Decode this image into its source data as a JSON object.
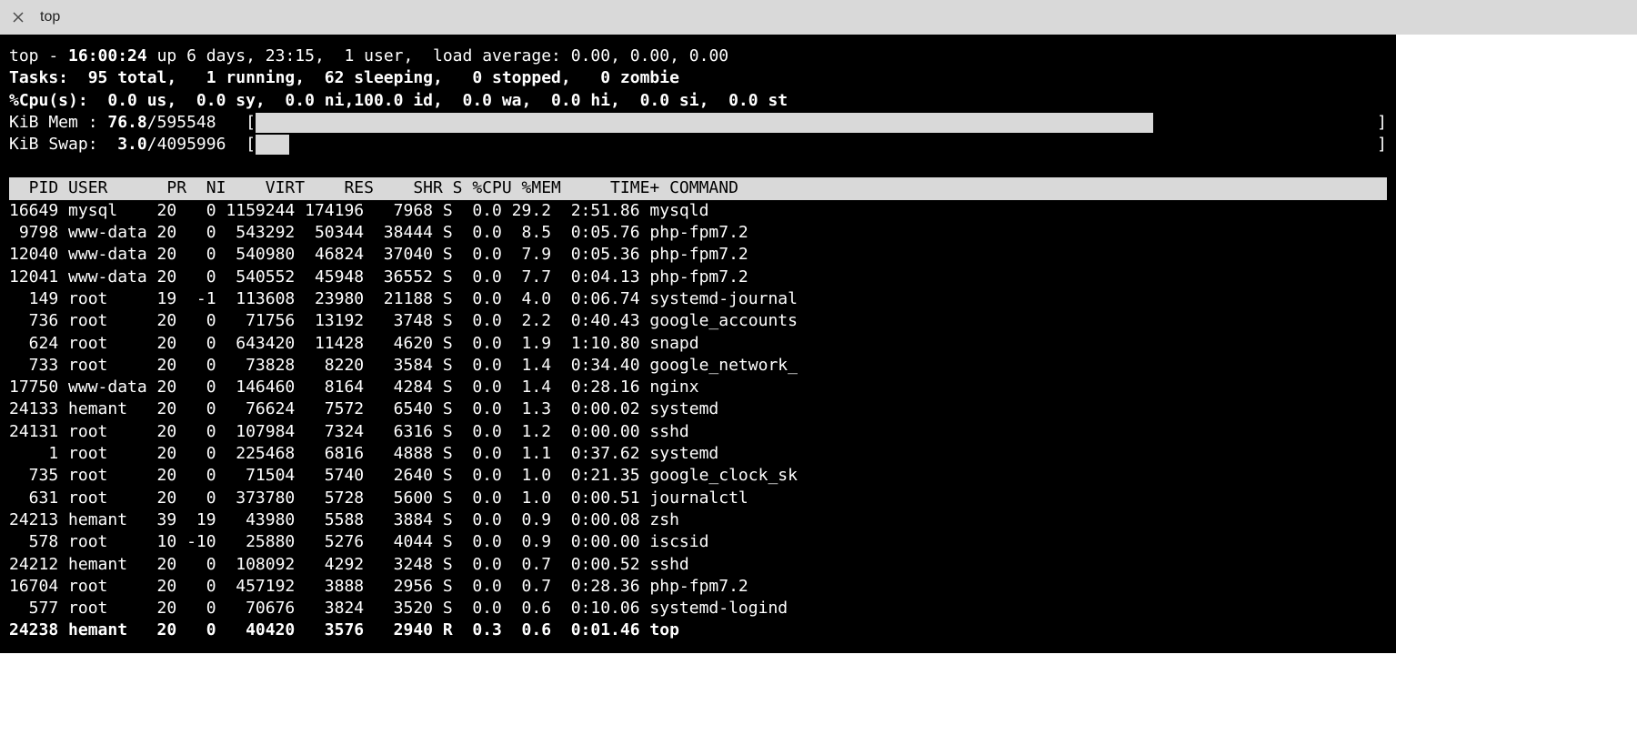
{
  "window": {
    "title": "top"
  },
  "summary": {
    "line1_a": "top - ",
    "line1_b": "16:00:24 ",
    "line1_c": "up 6 days, 23:15,  1 user,  load average: 0.00, 0.00, 0.00",
    "line2": "Tasks:  95 total,   1 running,  62 sleeping,   0 stopped,   0 zombie",
    "line3": "%Cpu(s):  0.0 us,  0.0 sy,  0.0 ni,100.0 id,  0.0 wa,  0.0 hi,  0.0 si,  0.0 st",
    "mem_label": "KiB Mem : ",
    "mem_used": "76.8",
    "mem_total": "/595548",
    "swap_label": "KiB Swap:  ",
    "swap_used": "3.0",
    "swap_total": "/4095996"
  },
  "mem_fill_pct": 80,
  "swap_fill_pct": 3,
  "columns_header": "  PID USER      PR  NI    VIRT    RES    SHR S %CPU %MEM     TIME+ COMMAND",
  "processes": [
    {
      "pid": "16649",
      "user": "mysql   ",
      "pr": "20",
      "ni": "  0",
      "virt": "1159244",
      "res": "174196",
      "shr": "  7968",
      "s": "S",
      "cpu": " 0.0",
      "mem": "29.2",
      "time": " 2:51.86",
      "cmd": "mysqld",
      "bold": false
    },
    {
      "pid": " 9798",
      "user": "www-data",
      "pr": "20",
      "ni": "  0",
      "virt": " 543292",
      "res": " 50344",
      "shr": " 38444",
      "s": "S",
      "cpu": " 0.0",
      "mem": " 8.5",
      "time": " 0:05.76",
      "cmd": "php-fpm7.2",
      "bold": false
    },
    {
      "pid": "12040",
      "user": "www-data",
      "pr": "20",
      "ni": "  0",
      "virt": " 540980",
      "res": " 46824",
      "shr": " 37040",
      "s": "S",
      "cpu": " 0.0",
      "mem": " 7.9",
      "time": " 0:05.36",
      "cmd": "php-fpm7.2",
      "bold": false
    },
    {
      "pid": "12041",
      "user": "www-data",
      "pr": "20",
      "ni": "  0",
      "virt": " 540552",
      "res": " 45948",
      "shr": " 36552",
      "s": "S",
      "cpu": " 0.0",
      "mem": " 7.7",
      "time": " 0:04.13",
      "cmd": "php-fpm7.2",
      "bold": false
    },
    {
      "pid": "  149",
      "user": "root    ",
      "pr": "19",
      "ni": " -1",
      "virt": " 113608",
      "res": " 23980",
      "shr": " 21188",
      "s": "S",
      "cpu": " 0.0",
      "mem": " 4.0",
      "time": " 0:06.74",
      "cmd": "systemd-journal",
      "bold": false
    },
    {
      "pid": "  736",
      "user": "root    ",
      "pr": "20",
      "ni": "  0",
      "virt": "  71756",
      "res": " 13192",
      "shr": "  3748",
      "s": "S",
      "cpu": " 0.0",
      "mem": " 2.2",
      "time": " 0:40.43",
      "cmd": "google_accounts",
      "bold": false
    },
    {
      "pid": "  624",
      "user": "root    ",
      "pr": "20",
      "ni": "  0",
      "virt": " 643420",
      "res": " 11428",
      "shr": "  4620",
      "s": "S",
      "cpu": " 0.0",
      "mem": " 1.9",
      "time": " 1:10.80",
      "cmd": "snapd",
      "bold": false
    },
    {
      "pid": "  733",
      "user": "root    ",
      "pr": "20",
      "ni": "  0",
      "virt": "  73828",
      "res": "  8220",
      "shr": "  3584",
      "s": "S",
      "cpu": " 0.0",
      "mem": " 1.4",
      "time": " 0:34.40",
      "cmd": "google_network_",
      "bold": false
    },
    {
      "pid": "17750",
      "user": "www-data",
      "pr": "20",
      "ni": "  0",
      "virt": " 146460",
      "res": "  8164",
      "shr": "  4284",
      "s": "S",
      "cpu": " 0.0",
      "mem": " 1.4",
      "time": " 0:28.16",
      "cmd": "nginx",
      "bold": false
    },
    {
      "pid": "24133",
      "user": "hemant  ",
      "pr": "20",
      "ni": "  0",
      "virt": "  76624",
      "res": "  7572",
      "shr": "  6540",
      "s": "S",
      "cpu": " 0.0",
      "mem": " 1.3",
      "time": " 0:00.02",
      "cmd": "systemd",
      "bold": false
    },
    {
      "pid": "24131",
      "user": "root    ",
      "pr": "20",
      "ni": "  0",
      "virt": " 107984",
      "res": "  7324",
      "shr": "  6316",
      "s": "S",
      "cpu": " 0.0",
      "mem": " 1.2",
      "time": " 0:00.00",
      "cmd": "sshd",
      "bold": false
    },
    {
      "pid": "    1",
      "user": "root    ",
      "pr": "20",
      "ni": "  0",
      "virt": " 225468",
      "res": "  6816",
      "shr": "  4888",
      "s": "S",
      "cpu": " 0.0",
      "mem": " 1.1",
      "time": " 0:37.62",
      "cmd": "systemd",
      "bold": false
    },
    {
      "pid": "  735",
      "user": "root    ",
      "pr": "20",
      "ni": "  0",
      "virt": "  71504",
      "res": "  5740",
      "shr": "  2640",
      "s": "S",
      "cpu": " 0.0",
      "mem": " 1.0",
      "time": " 0:21.35",
      "cmd": "google_clock_sk",
      "bold": false
    },
    {
      "pid": "  631",
      "user": "root    ",
      "pr": "20",
      "ni": "  0",
      "virt": " 373780",
      "res": "  5728",
      "shr": "  5600",
      "s": "S",
      "cpu": " 0.0",
      "mem": " 1.0",
      "time": " 0:00.51",
      "cmd": "journalctl",
      "bold": false
    },
    {
      "pid": "24213",
      "user": "hemant  ",
      "pr": "39",
      "ni": " 19",
      "virt": "  43980",
      "res": "  5588",
      "shr": "  3884",
      "s": "S",
      "cpu": " 0.0",
      "mem": " 0.9",
      "time": " 0:00.08",
      "cmd": "zsh",
      "bold": false
    },
    {
      "pid": "  578",
      "user": "root    ",
      "pr": "10",
      "ni": "-10",
      "virt": "  25880",
      "res": "  5276",
      "shr": "  4044",
      "s": "S",
      "cpu": " 0.0",
      "mem": " 0.9",
      "time": " 0:00.00",
      "cmd": "iscsid",
      "bold": false
    },
    {
      "pid": "24212",
      "user": "hemant  ",
      "pr": "20",
      "ni": "  0",
      "virt": " 108092",
      "res": "  4292",
      "shr": "  3248",
      "s": "S",
      "cpu": " 0.0",
      "mem": " 0.7",
      "time": " 0:00.52",
      "cmd": "sshd",
      "bold": false
    },
    {
      "pid": "16704",
      "user": "root    ",
      "pr": "20",
      "ni": "  0",
      "virt": " 457192",
      "res": "  3888",
      "shr": "  2956",
      "s": "S",
      "cpu": " 0.0",
      "mem": " 0.7",
      "time": " 0:28.36",
      "cmd": "php-fpm7.2",
      "bold": false
    },
    {
      "pid": "  577",
      "user": "root    ",
      "pr": "20",
      "ni": "  0",
      "virt": "  70676",
      "res": "  3824",
      "shr": "  3520",
      "s": "S",
      "cpu": " 0.0",
      "mem": " 0.6",
      "time": " 0:10.06",
      "cmd": "systemd-logind",
      "bold": false
    },
    {
      "pid": "24238",
      "user": "hemant  ",
      "pr": "20",
      "ni": "  0",
      "virt": "  40420",
      "res": "  3576",
      "shr": "  2940",
      "s": "R",
      "cpu": " 0.3",
      "mem": " 0.6",
      "time": " 0:01.46",
      "cmd": "top",
      "bold": true
    }
  ]
}
